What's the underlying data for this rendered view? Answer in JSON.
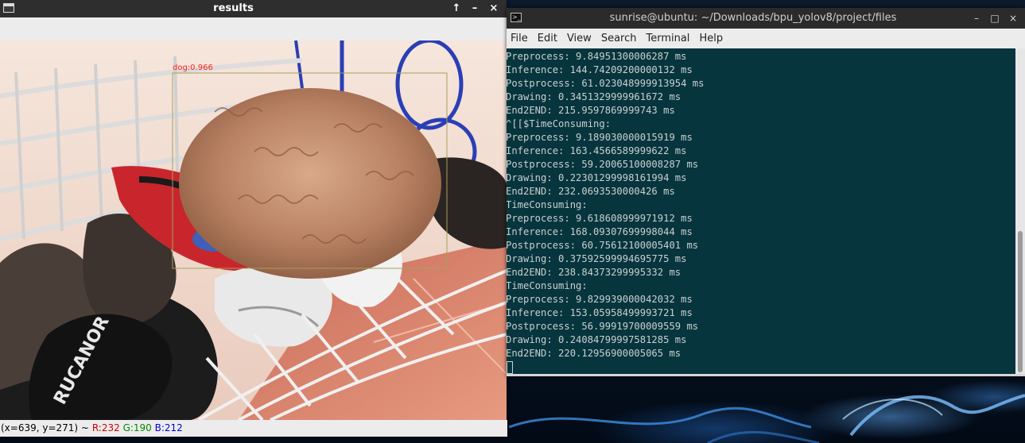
{
  "image_window": {
    "title": "results",
    "buttons": {
      "maximize": "↑",
      "minimize": "–",
      "close": "×"
    },
    "detection": {
      "label": "dog:0.966"
    },
    "status": {
      "coords": "(x=639, y=271) ~",
      "r": "R:232",
      "g": "G:190",
      "b": "B:212"
    },
    "brand_text": "RUCANOR"
  },
  "terminal": {
    "title": "sunrise@ubuntu: ~/Downloads/bpu_yolov8/project/files",
    "buttons": {
      "minimize": "–",
      "maximize": "□",
      "close": "×"
    },
    "menu": [
      "File",
      "Edit",
      "View",
      "Search",
      "Terminal",
      "Help"
    ],
    "lines": [
      "Preprocess: 9.84951300006287 ms",
      "Inference: 144.74209200000132 ms",
      "Postprocess: 61.023048999913954 ms",
      "Drawing: 0.3451329999961672 ms",
      "End2END: 215.9597869999743 ms",
      "^[[$TimeConsuming:",
      "Preprocess: 9.189030000015919 ms",
      "Inference: 163.4566589999622 ms",
      "Postprocess: 59.20065100008287 ms",
      "Drawing: 0.22301299998161994 ms",
      "End2END: 232.0693530000426 ms",
      "TimeConsuming:",
      "Preprocess: 9.618608999971912 ms",
      "Inference: 168.09307699998044 ms",
      "Postprocess: 60.75612100005401 ms",
      "Drawing: 0.37592599994695775 ms",
      "End2END: 238.84373299995332 ms",
      "TimeConsuming:",
      "Preprocess: 9.829939000042032 ms",
      "Inference: 153.05958499993721 ms",
      "Postprocess: 56.99919700009559 ms",
      "Drawing: 0.24084799997581285 ms",
      "End2END: 220.12956900005065 ms"
    ],
    "scroll_fraction": 0.58
  },
  "colors": {
    "terminal_bg": "#07353d",
    "terminal_fg": "#c8d0d0",
    "bbox": "#a8a05a",
    "bbox_label": "#ff2020"
  }
}
